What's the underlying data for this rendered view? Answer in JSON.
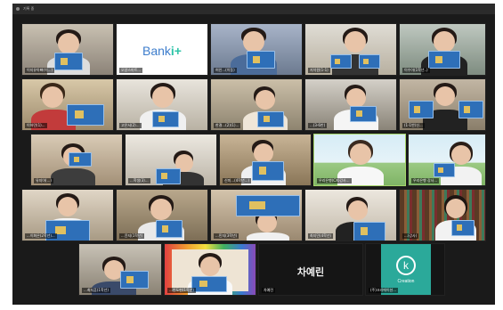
{
  "window": {
    "title": "기록 중"
  },
  "tiles": [
    {
      "name": "아동1",
      "label": "이지유아빠(이...)"
    },
    {
      "name": "bank-logo",
      "label": "오양스마트...",
      "logo_text": "Bank",
      "logo_plus": "i+"
    },
    {
      "name": "아동2",
      "label": "허인...(이동)"
    },
    {
      "name": "아동3",
      "label": "지석원(1-1)"
    },
    {
      "name": "아동4",
      "label": "이수아(1학년..)"
    },
    {
      "name": "아동5",
      "label": "이하민(1)..."
    },
    {
      "name": "아동6",
      "label": "고은서(2)..."
    },
    {
      "name": "아동7",
      "label": "한결...(2)(1)..."
    },
    {
      "name": "아동8",
      "label": "...(3-6반)"
    },
    {
      "name": "아동9",
      "label": "(1-1반)신..."
    },
    {
      "name": "아동10",
      "label": "유지아(...)"
    },
    {
      "name": "아동11",
      "label": "...학생(3)..."
    },
    {
      "name": "아동12",
      "label": "신미...(4학년...)"
    },
    {
      "name": "teacher1",
      "label": "우리은행(CX)강사..."
    },
    {
      "name": "teacher2",
      "label": "우리은행 강사..."
    },
    {
      "name": "아동13",
      "label": "...이화은(2학년)..."
    },
    {
      "name": "아동14",
      "label": "...윤지(1학년)"
    },
    {
      "name": "아동15",
      "label": "...민지(3학년)"
    },
    {
      "name": "아동16",
      "label": "최지민(4학년)"
    },
    {
      "name": "teacher3",
      "label": "...(강사)"
    },
    {
      "name": "아동17",
      "label": "...최지훈(1학년)"
    },
    {
      "name": "아동18",
      "label": "...안도현(1학년)"
    },
    {
      "name": "name-only",
      "label": "차예린",
      "big": "차예린"
    },
    {
      "name": "creation",
      "label": "(주)크리에이션...",
      "logo_text": "Creation",
      "logo_mark": "k"
    }
  ],
  "colors": {
    "active_border": "#a6d66b",
    "creation_bg": "#2ba99a",
    "bank_blue": "#3d7dcc",
    "bank_plus": "#2ec4a8"
  }
}
